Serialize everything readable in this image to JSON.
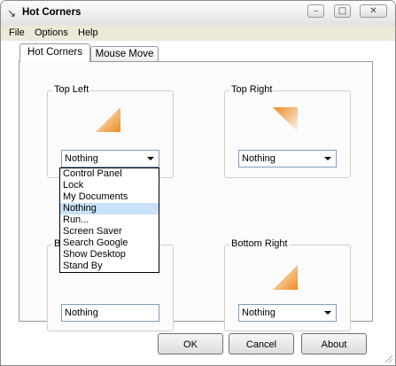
{
  "window": {
    "title": "Hot Corners",
    "app_icon": "arrow-icon",
    "controls": {
      "minimize": "minimize-icon",
      "maximize": "maximize-icon",
      "close": "close-icon"
    }
  },
  "menu": [
    "File",
    "Options",
    "Help"
  ],
  "tabs": [
    {
      "label": "Hot Corners",
      "active": true
    },
    {
      "label": "Mouse Move",
      "active": false
    }
  ],
  "corners": {
    "top_left": {
      "label": "Top Left",
      "selected": "Nothing"
    },
    "top_right": {
      "label": "Top Right",
      "selected": "Nothing"
    },
    "bottom_left": {
      "label": "B",
      "selected": "Nothing"
    },
    "bottom_right": {
      "label": "Bottom Right",
      "selected": "Nothing"
    }
  },
  "dropdown": {
    "options": [
      "Control Panel",
      "Lock",
      "My Documents",
      "Nothing",
      "Run...",
      "Screen Saver",
      "Search Google",
      "Show Desktop",
      "Stand By"
    ],
    "highlighted": "Nothing"
  },
  "buttons": {
    "ok": "OK",
    "cancel": "Cancel",
    "about": "About"
  },
  "colors": {
    "corner_gradient": "#f08a1a",
    "selection_highlight": "#c9e1f6",
    "combo_border": "#7f9db9"
  }
}
